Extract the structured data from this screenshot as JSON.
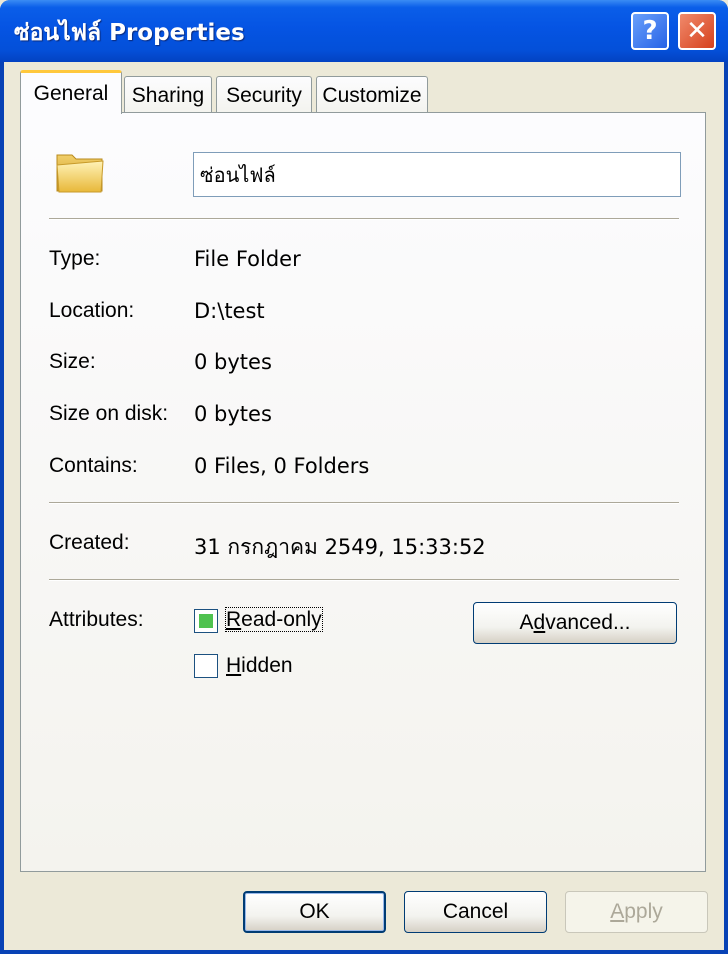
{
  "window": {
    "title": "ซ่อนไฟล์ Properties"
  },
  "titlebar_buttons": {
    "help": "?",
    "close": "✕"
  },
  "tabs": [
    {
      "label": "General"
    },
    {
      "label": "Sharing"
    },
    {
      "label": "Security"
    },
    {
      "label": "Customize"
    }
  ],
  "general": {
    "icon": "folder-icon",
    "name": "ซ่อนไฟล์",
    "type_label": "Type:",
    "type_value": "File Folder",
    "location_label": "Location:",
    "location_value": "D:\\test",
    "size_label": "Size:",
    "size_value": "0 bytes",
    "size_on_disk_label": "Size on disk:",
    "size_on_disk_value": "0 bytes",
    "contains_label": "Contains:",
    "contains_value": "0 Files, 0 Folders",
    "created_label": "Created:",
    "created_value": "31 กรกฎาคม 2549, 15:33:52",
    "attributes_label": "Attributes:",
    "readonly_label_pre": "",
    "readonly_label_key": "R",
    "readonly_label_post": "ead-only",
    "readonly_state": "indeterminate",
    "hidden_label_key": "H",
    "hidden_label_post": "idden",
    "hidden_state": "unchecked",
    "advanced_pre": "A",
    "advanced_key": "d",
    "advanced_post": "vanced..."
  },
  "buttons": {
    "ok": "OK",
    "cancel": "Cancel",
    "apply_key": "A",
    "apply_post": "pply"
  },
  "colors": {
    "titlebar": "#0554e3",
    "window_frame": "#0842b5",
    "face": "#ece9d8",
    "tab_highlight": "#ffc83c",
    "readonly_fill": "#4fc24f"
  }
}
